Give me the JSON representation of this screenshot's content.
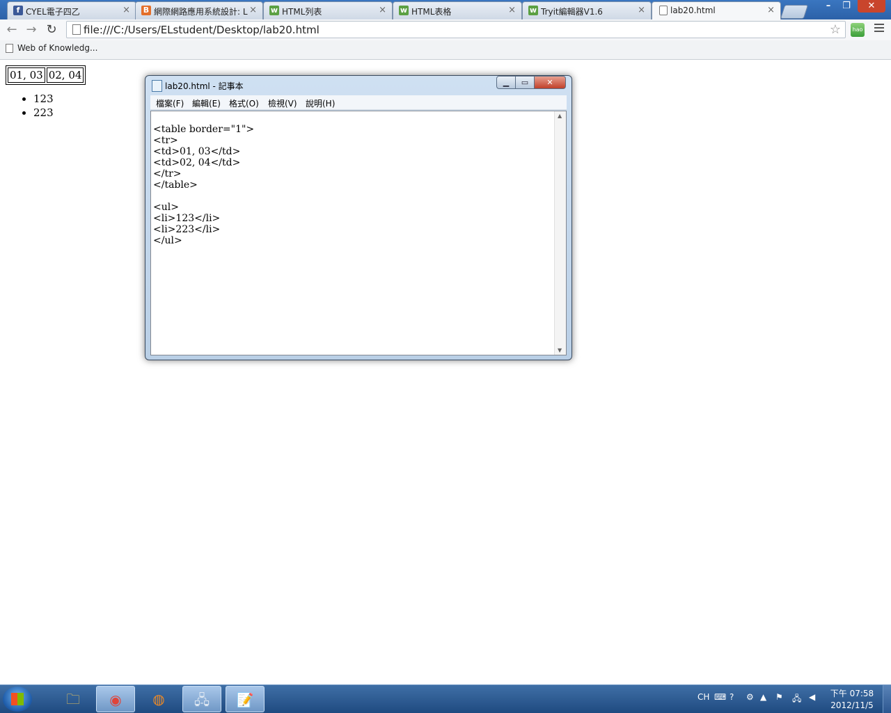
{
  "browser": {
    "tabs": [
      {
        "title": "CYEL電子四乙",
        "icon": "facebook-icon",
        "color": "#3b5998",
        "glyph": "f"
      },
      {
        "title": "網際網路應用系統設計: L",
        "icon": "blogger-icon",
        "color": "#e46f2a",
        "glyph": "B"
      },
      {
        "title": "HTML列表",
        "icon": "w3-icon",
        "color": "#5ba043",
        "glyph": "w"
      },
      {
        "title": "HTML表格",
        "icon": "w3-icon",
        "color": "#5ba043",
        "glyph": "w"
      },
      {
        "title": "Tryit編輯器V1.6",
        "icon": "w3-icon",
        "color": "#5ba043",
        "glyph": "w"
      },
      {
        "title": "lab20.html",
        "icon": "page-icon",
        "color": "#ffffff",
        "glyph": ""
      }
    ],
    "tab_close": "×",
    "window_buttons": {
      "minimize": "–",
      "maximize": "❐",
      "close": "✕"
    },
    "nav": {
      "back": "←",
      "forward": "→",
      "reload": "↻"
    },
    "address": "file:///C:/Users/ELstudent/Desktop/lab20.html",
    "star": "☆",
    "extension_label": "hao",
    "bookmarks": [
      {
        "title": "Web of Knowledg..."
      }
    ]
  },
  "page": {
    "table_cells": [
      "01, 03",
      "02, 04"
    ],
    "list_items": [
      "123",
      "223"
    ]
  },
  "notepad": {
    "title": "lab20.html - 記事本",
    "buttons": {
      "minimize": "▁",
      "maximize": "▭",
      "close": "✕"
    },
    "menus": [
      "檔案(F)",
      "編輯(E)",
      "格式(O)",
      "檢視(V)",
      "說明(H)"
    ],
    "text": "<table border=\"1\">\n<tr>\n<td>01, 03</td>\n<td>02, 04</td>\n</tr>\n</table>\n\n<ul>\n<li>123</li>\n<li>223</li>\n</ul>"
  },
  "taskbar": {
    "items": [
      {
        "name": "explorer-icon",
        "glyph": "🗀"
      },
      {
        "name": "chrome-icon",
        "glyph": "◉"
      },
      {
        "name": "firefox-icon",
        "glyph": "◍"
      },
      {
        "name": "network-icon",
        "glyph": "🖧"
      },
      {
        "name": "notepad-icon",
        "glyph": "📝"
      }
    ],
    "ime": "CH",
    "time": "下午 07:58",
    "date": "2012/11/5"
  }
}
